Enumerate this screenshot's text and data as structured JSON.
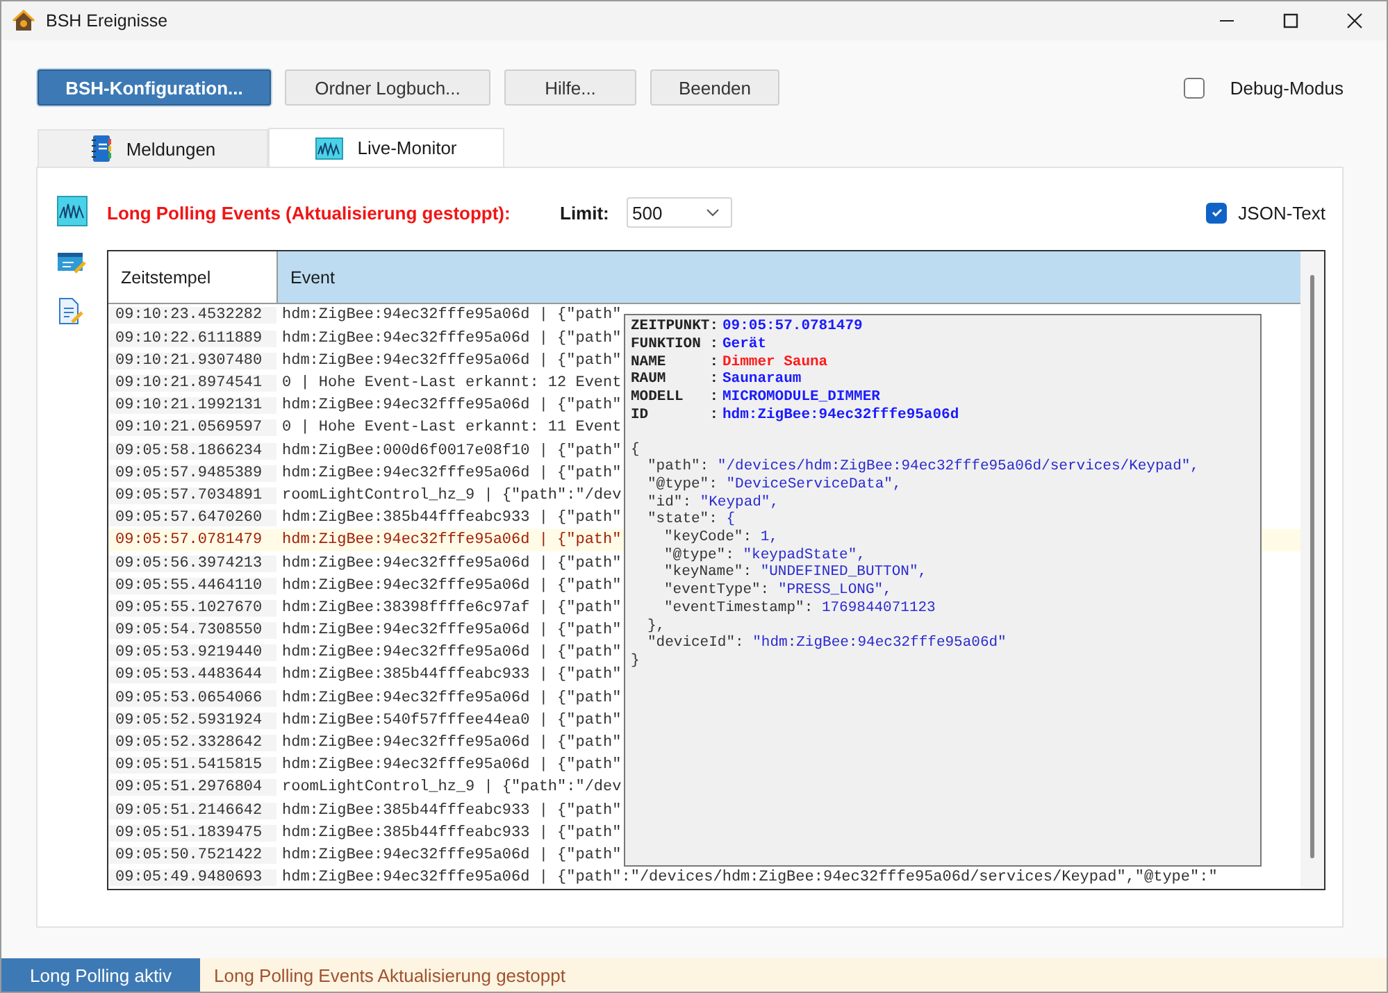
{
  "window": {
    "title": "BSH Ereignisse"
  },
  "toolbar": {
    "buttons": [
      {
        "label": "BSH-Konfiguration...",
        "selected": true
      },
      {
        "label": "Ordner Logbuch...",
        "selected": false
      },
      {
        "label": "Hilfe...",
        "selected": false
      },
      {
        "label": "Beenden",
        "selected": false
      }
    ],
    "debug": {
      "label": "Debug-Modus",
      "checked": false
    }
  },
  "tabs": [
    {
      "label": "Meldungen",
      "selected": false,
      "kind": "notebook"
    },
    {
      "label": "Live-Monitor",
      "selected": true,
      "kind": "monitor"
    }
  ],
  "monitor": {
    "title": "Long Polling Events (Aktualisierung gestoppt):",
    "limit_label": "Limit:",
    "limit_value": "500",
    "json_text": {
      "label": "JSON-Text",
      "checked": true
    },
    "table": {
      "columns": [
        "Zeitstempel",
        "Event"
      ],
      "rows": [
        {
          "time": "09:10:23.4532282",
          "event": "hdm:ZigBee:94ec32fffe95a06d | {\"path\"",
          "selected": false
        },
        {
          "time": "09:10:22.6111889",
          "event": "hdm:ZigBee:94ec32fffe95a06d | {\"path\"",
          "selected": false
        },
        {
          "time": "09:10:21.9307480",
          "event": "hdm:ZigBee:94ec32fffe95a06d | {\"path\"",
          "selected": false
        },
        {
          "time": "09:10:21.8974541",
          "event": "0 | Hohe Event-Last erkannt: 12 Event",
          "selected": false
        },
        {
          "time": "09:10:21.1992131",
          "event": "hdm:ZigBee:94ec32fffe95a06d | {\"path\"",
          "selected": false
        },
        {
          "time": "09:10:21.0569597",
          "event": "0 | Hohe Event-Last erkannt: 11 Event",
          "selected": false
        },
        {
          "time": "09:05:58.1866234",
          "event": "hdm:ZigBee:000d6f0017e08f10 | {\"path\"",
          "selected": false
        },
        {
          "time": "09:05:57.9485389",
          "event": "hdm:ZigBee:94ec32fffe95a06d | {\"path\"",
          "selected": false
        },
        {
          "time": "09:05:57.7034891",
          "event": "roomLightControl_hz_9 | {\"path\":\"/dev",
          "selected": false
        },
        {
          "time": "09:05:57.6470260",
          "event": "hdm:ZigBee:385b44fffeabc933 | {\"path\"",
          "selected": false
        },
        {
          "time": "09:05:57.0781479",
          "event": "hdm:ZigBee:94ec32fffe95a06d | {\"path\"",
          "selected": true
        },
        {
          "time": "09:05:56.3974213",
          "event": "hdm:ZigBee:94ec32fffe95a06d | {\"path\"",
          "selected": false
        },
        {
          "time": "09:05:55.4464110",
          "event": "hdm:ZigBee:94ec32fffe95a06d | {\"path\"",
          "selected": false
        },
        {
          "time": "09:05:55.1027670",
          "event": "hdm:ZigBee:38398ffffe6c97af | {\"path\"",
          "selected": false
        },
        {
          "time": "09:05:54.7308550",
          "event": "hdm:ZigBee:94ec32fffe95a06d | {\"path\"",
          "selected": false
        },
        {
          "time": "09:05:53.9219440",
          "event": "hdm:ZigBee:94ec32fffe95a06d | {\"path\"",
          "selected": false
        },
        {
          "time": "09:05:53.4483644",
          "event": "hdm:ZigBee:385b44fffeabc933 | {\"path\"",
          "selected": false
        },
        {
          "time": "09:05:53.0654066",
          "event": "hdm:ZigBee:94ec32fffe95a06d | {\"path\"",
          "selected": false
        },
        {
          "time": "09:05:52.5931924",
          "event": "hdm:ZigBee:540f57fffee44ea0 | {\"path\"",
          "selected": false
        },
        {
          "time": "09:05:52.3328642",
          "event": "hdm:ZigBee:94ec32fffe95a06d | {\"path\"",
          "selected": false
        },
        {
          "time": "09:05:51.5415815",
          "event": "hdm:ZigBee:94ec32fffe95a06d | {\"path\"",
          "selected": false
        },
        {
          "time": "09:05:51.2976804",
          "event": "roomLightControl_hz_9 | {\"path\":\"/dev",
          "selected": false
        },
        {
          "time": "09:05:51.2146642",
          "event": "hdm:ZigBee:385b44fffeabc933 | {\"path\"",
          "selected": false
        },
        {
          "time": "09:05:51.1839475",
          "event": "hdm:ZigBee:385b44fffeabc933 | {\"path\"",
          "selected": false
        },
        {
          "time": "09:05:50.7521422",
          "event": "hdm:ZigBee:94ec32fffe95a06d | {\"path\"",
          "selected": false
        },
        {
          "time": "09:05:49.9480693",
          "event": "hdm:ZigBee:94ec32fffe95a06d | {\"path\":\"/devices/hdm:ZigBee:94ec32fffe95a06d/services/Keypad\",\"@type\":\"",
          "selected": false
        }
      ]
    },
    "tooltip": {
      "info": [
        {
          "label": "ZEITPUNKT:",
          "value": "09:05:57.0781479",
          "color": "#1a1aff"
        },
        {
          "label": "FUNKTION :",
          "value": "Gerät",
          "color": "#1a1aff"
        },
        {
          "label": "NAME     :",
          "value": "Dimmer Sauna",
          "color": "#ff1a1a"
        },
        {
          "label": "RAUM     :",
          "value": "Saunaraum",
          "color": "#1a1aff"
        },
        {
          "label": "MODELL   :",
          "value": "MICROMODULE_DIMMER",
          "color": "#1a1aff"
        },
        {
          "label": "ID       :",
          "value": "hdm:ZigBee:94ec32fffe95a06d",
          "color": "#1a1aff"
        }
      ],
      "json": {
        "open": "{",
        "close": "}",
        "entries": [
          {
            "key": "\"path\":",
            "value": "\"/devices/hdm:ZigBee:94ec32fffe95a06d/services/Keypad\","
          },
          {
            "key": "\"@type\":",
            "value": "\"DeviceServiceData\","
          },
          {
            "key": "\"id\":",
            "value": "\"Keypad\","
          },
          {
            "key": "\"state\":",
            "value": "{",
            "close": "},",
            "children": [
              {
                "key": "\"keyCode\":",
                "value": "1,"
              },
              {
                "key": "\"@type\":",
                "value": "\"keypadState\","
              },
              {
                "key": "\"keyName\":",
                "value": "\"UNDEFINED_BUTTON\","
              },
              {
                "key": "\"eventType\":",
                "value": "\"PRESS_LONG\","
              },
              {
                "key": "\"eventTimestamp\":",
                "value": "1769844071123"
              }
            ]
          },
          {
            "key": "\"deviceId\":",
            "value": "\"hdm:ZigBee:94ec32fffe95a06d\""
          }
        ]
      }
    }
  },
  "status_bar": {
    "state": "Long Polling aktiv",
    "message": "Long Polling Events Aktualisierung gestoppt"
  }
}
